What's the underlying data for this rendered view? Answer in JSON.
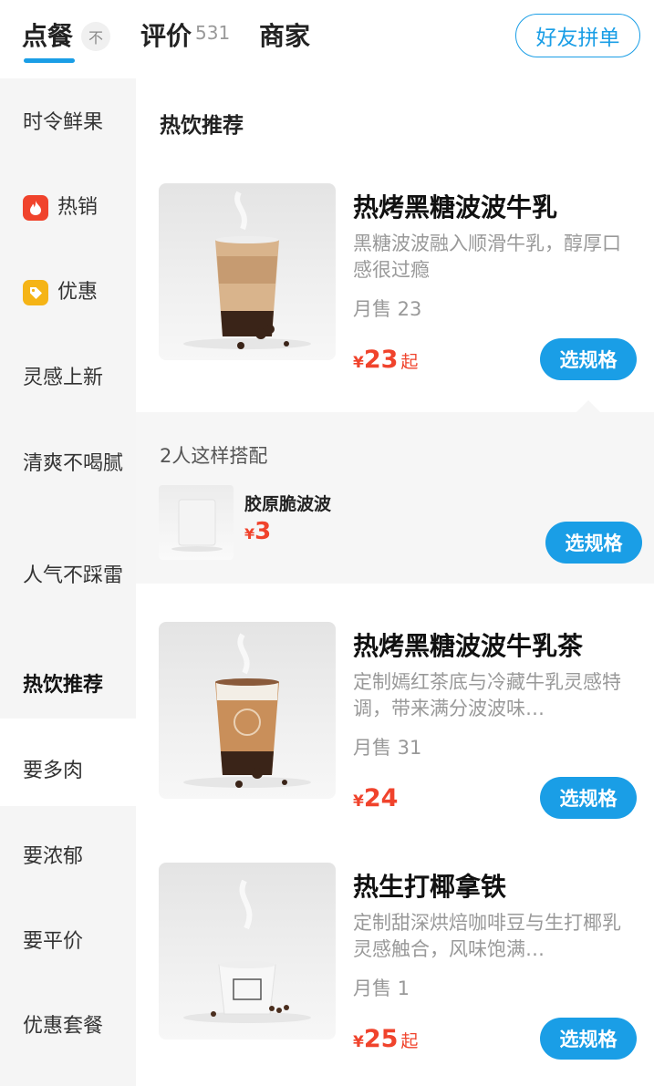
{
  "tabs": {
    "order": "点餐",
    "pin": "不",
    "review": "评价",
    "review_count": "531",
    "shop": "商家",
    "group_order": "好友拼单"
  },
  "sidebar": {
    "items": [
      {
        "label": "时令鲜果"
      },
      {
        "label": "热销",
        "icon": "flame-icon"
      },
      {
        "label": "优惠",
        "icon": "tag-icon"
      },
      {
        "label": "灵感上新"
      },
      {
        "label": "清爽不喝腻"
      },
      {
        "label": "人气不踩雷"
      },
      {
        "label": "热饮推荐",
        "active": true
      },
      {
        "label": "要多肉"
      },
      {
        "label": "要浓郁"
      },
      {
        "label": "要平价"
      },
      {
        "label": "优惠套餐"
      }
    ]
  },
  "main": {
    "section_title": "热饮推荐",
    "products": [
      {
        "name": "热烤黑糖波波牛乳",
        "desc": "黑糖波波融入顺滑牛乳，醇厚口感很过瘾",
        "sales": "月售 23",
        "currency": "¥",
        "price": "23",
        "from": "起",
        "button": "选规格"
      },
      {
        "name": "热烤黑糖波波牛乳茶",
        "desc": "定制嫣红茶底与冷藏牛乳灵感特调，带来满分波波味…",
        "sales": "月售 31",
        "currency": "¥",
        "price": "24",
        "from": "",
        "button": "选规格"
      },
      {
        "name": "热生打椰拿铁",
        "desc": "定制甜深烘焙咖啡豆与生打椰乳灵感触合，风味饱满…",
        "sales": "月售 1",
        "currency": "¥",
        "price": "25",
        "from": "起",
        "button": "选规格"
      }
    ],
    "combo": {
      "title": "2人这样搭配",
      "item_name": "胶原脆波波",
      "currency": "¥",
      "price": "3",
      "button": "选规格"
    }
  },
  "colors": {
    "accent": "#1a9ee6",
    "price": "#f0432c",
    "hot_badge": "#f0432c",
    "discount_badge": "#f5b416"
  }
}
